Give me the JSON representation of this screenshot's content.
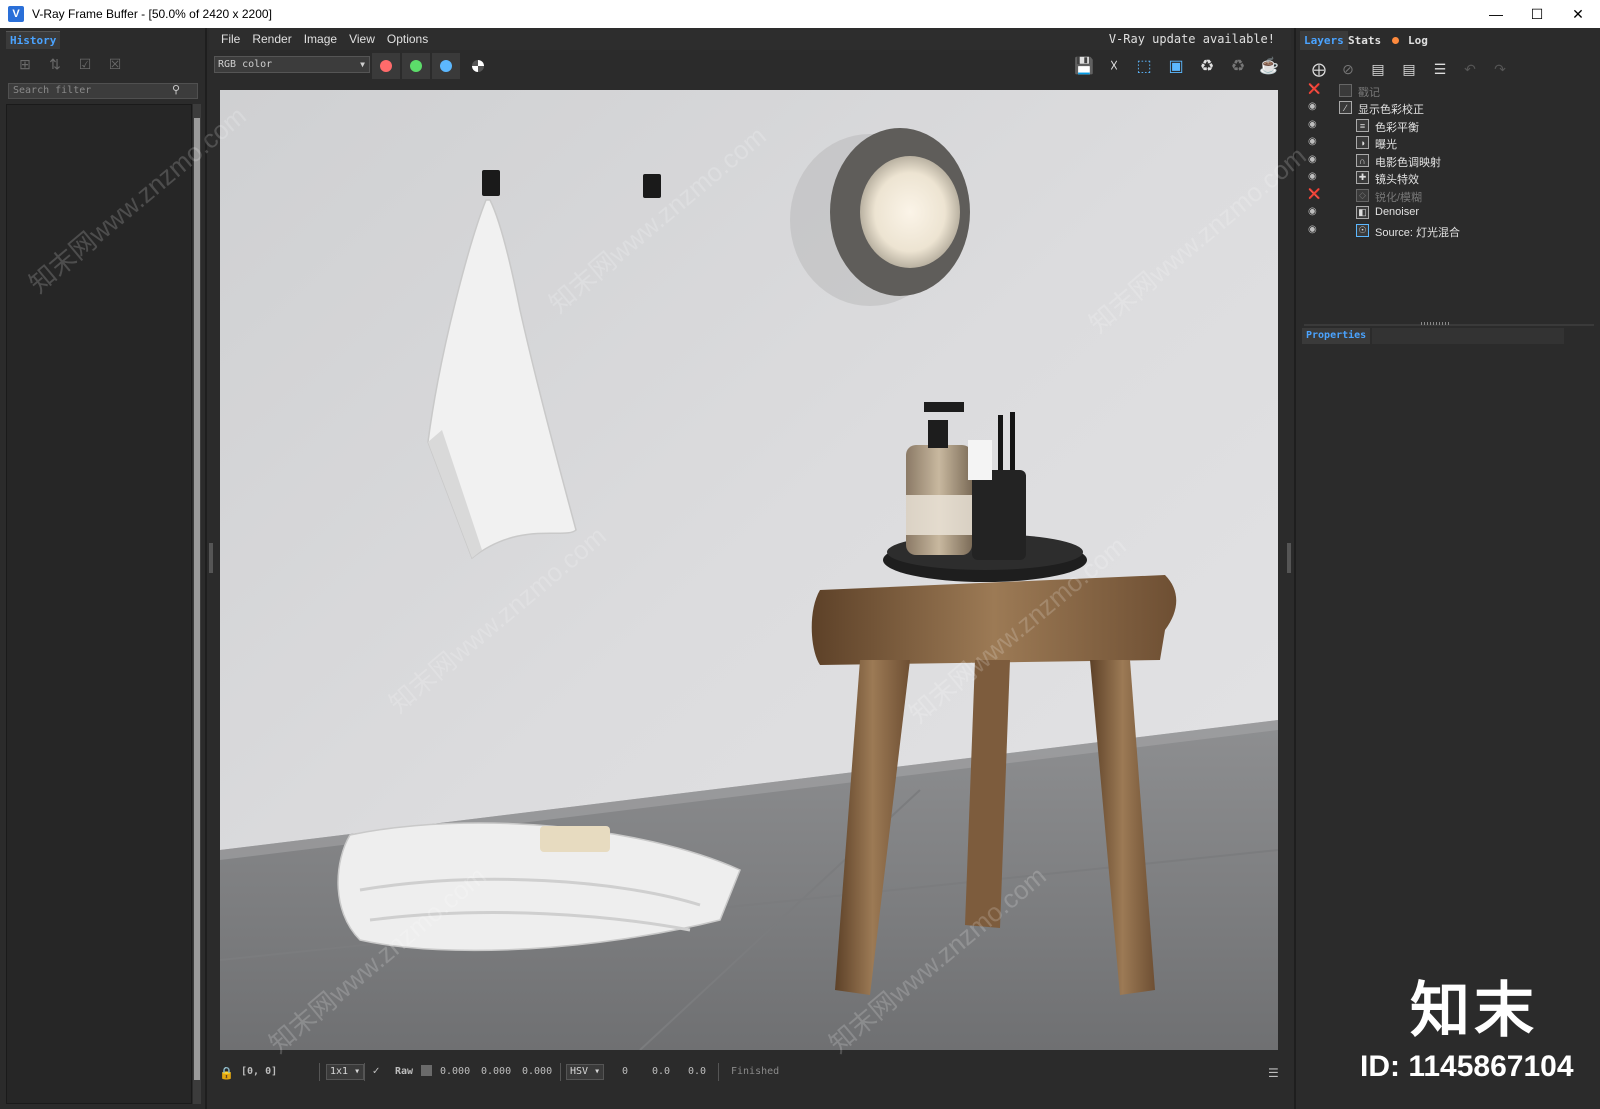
{
  "window": {
    "title": "V-Ray Frame Buffer - [50.0% of 2420 x 2200]",
    "app_icon": "vray-logo-icon",
    "controls": [
      "minimize-icon",
      "maximize-icon",
      "close-icon"
    ]
  },
  "history": {
    "tab_label": "History",
    "search_placeholder": "Search filter"
  },
  "menu": {
    "items": [
      "File",
      "Render",
      "Image",
      "View",
      "Options"
    ],
    "update_note": "V-Ray update available!"
  },
  "toolbar": {
    "channel": "RGB color",
    "colors": {
      "red": "#ff6b6b",
      "green": "#5cdc6a",
      "blue": "#5cb8ff"
    }
  },
  "layers_panel": {
    "tabs": [
      "Layers",
      "Stats",
      "Log"
    ],
    "log_dot_color": "#ff8a3d",
    "layers": [
      {
        "label": "戳记",
        "enabled": false,
        "indent": 0
      },
      {
        "label": "显示色彩校正",
        "enabled": true,
        "indent": 0
      },
      {
        "label": "色彩平衡",
        "enabled": true,
        "indent": 1
      },
      {
        "label": "曝光",
        "enabled": true,
        "indent": 1
      },
      {
        "label": "电影色调映射",
        "enabled": true,
        "indent": 1
      },
      {
        "label": "镜头特效",
        "enabled": true,
        "indent": 1
      },
      {
        "label": "锐化/模糊",
        "enabled": false,
        "indent": 1
      },
      {
        "label": "Denoiser",
        "enabled": true,
        "indent": 1
      },
      {
        "label": "Source: 灯光混合",
        "enabled": true,
        "indent": 1
      }
    ],
    "properties_label": "Properties"
  },
  "status": {
    "coords": "[0, 0]",
    "zoom": "1x1",
    "mode": "Raw",
    "rgb_values": [
      "0.000",
      "0.000",
      "0.000"
    ],
    "color_space": "HSV",
    "hsv_values": [
      "0",
      "0.0",
      "0.0"
    ],
    "state": "Finished"
  },
  "watermark": {
    "text": "知末网www.znzmo.com",
    "logo": "知末",
    "id": "ID: 1145867104"
  }
}
